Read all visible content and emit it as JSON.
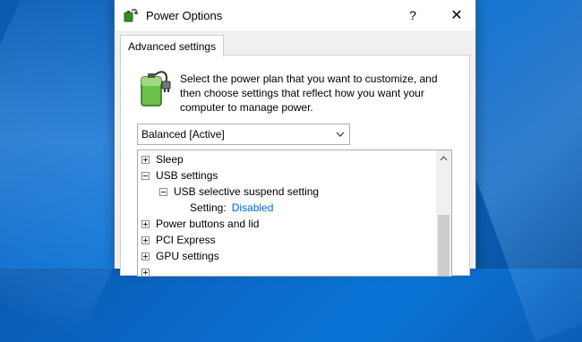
{
  "window": {
    "title": "Power Options",
    "help_label": "?",
    "close_label": "✕"
  },
  "tabs": [
    {
      "label": "Advanced settings",
      "active": true
    }
  ],
  "description": "Select the power plan that you want to customize, and then choose settings that reflect how you want your computer to manage power.",
  "plan_select": {
    "selected": "Balanced [Active]"
  },
  "tree": {
    "items": [
      {
        "label": "Sleep",
        "expanded": false
      },
      {
        "label": "USB settings",
        "expanded": true
      },
      {
        "label": "USB selective suspend setting",
        "expanded": true
      },
      {
        "setting_label": "Setting:",
        "setting_value": "Disabled"
      },
      {
        "label": "Power buttons and lid",
        "expanded": false
      },
      {
        "label": "PCI Express",
        "expanded": false
      },
      {
        "label": "GPU settings",
        "expanded": false
      }
    ]
  },
  "colors": {
    "link_value": "#0066cc",
    "desktop_blue": "#0a66c4"
  },
  "icons": {
    "title": "power-options-icon",
    "battery": "battery-plug-icon"
  }
}
